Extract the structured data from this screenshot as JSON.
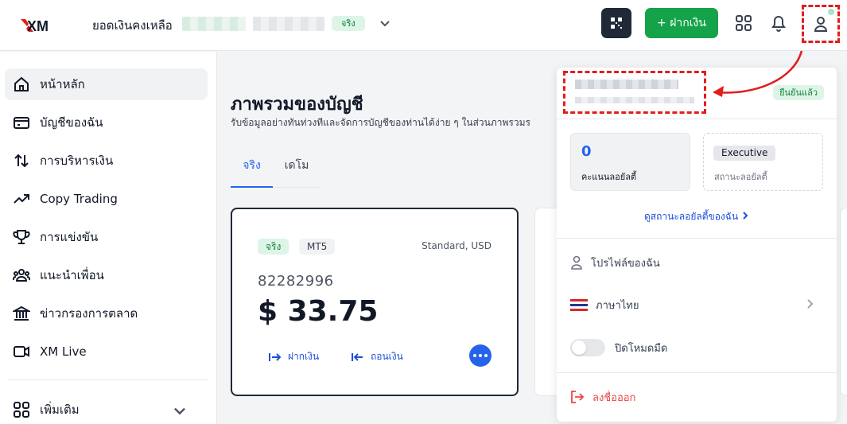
{
  "header": {
    "logo": "XM",
    "balance_label": "ยอดเงินคงเหลือ",
    "account_badge": "จริง",
    "deposit_button": "+ ฝากเงิน",
    "icons": [
      "qr-code-icon",
      "apps-grid-icon",
      "bell-icon",
      "user-icon"
    ]
  },
  "sidebar": {
    "items": [
      {
        "label": "หน้าหลัก",
        "icon": "home-icon"
      },
      {
        "label": "บัญชีของฉัน",
        "icon": "wallet-icon"
      },
      {
        "label": "การบริหารเงิน",
        "icon": "transfer-arrows-icon"
      },
      {
        "label": "Copy Trading",
        "icon": "trend-up-icon"
      },
      {
        "label": "การแข่งขัน",
        "icon": "trophy-icon"
      },
      {
        "label": "แนะนำเพื่อน",
        "icon": "users-icon"
      },
      {
        "label": "ข่าวกรองการตลาด",
        "icon": "bank-icon"
      },
      {
        "label": "XM Live",
        "icon": "video-icon"
      }
    ],
    "more": {
      "label": "เพิ่มเติม",
      "icon": "apps-grid-icon"
    }
  },
  "main": {
    "title": "ภาพรวมของบัญชี",
    "subtitle": "รับข้อมูลอย่างทันท่วงทีและจัดการบัญชีของท่านได้ง่าย ๆ ในส่วนภาพรวมร",
    "tabs": [
      {
        "label": "จริง"
      },
      {
        "label": "เดโม"
      }
    ],
    "card": {
      "badge_real": "จริง",
      "badge_platform": "MT5",
      "type": "Standard, USD",
      "account_number": "82282996",
      "balance": "$ 33.75",
      "deposit": "ฝากเงิน",
      "withdraw": "ถอนเงิน"
    }
  },
  "panel": {
    "verified": "ยืนยันแล้ว",
    "loyalty_points": "0",
    "loyalty_points_label": "คะแนนลอยัลตี้",
    "status_badge": "Executive",
    "status_label": "สถานะลอยัลตี้",
    "loyalty_link": "ดูสถานะลอยัลตี้ของฉัน",
    "profile": "โปรไฟล์ของฉัน",
    "language": "ภาษาไทย",
    "dark_mode": "ปิดโหมดมืด",
    "logout": "ลงชื่อออก"
  },
  "colors": {
    "accent": "#2563eb",
    "green": "#15a34a",
    "annotation_red": "#e11d1d"
  }
}
